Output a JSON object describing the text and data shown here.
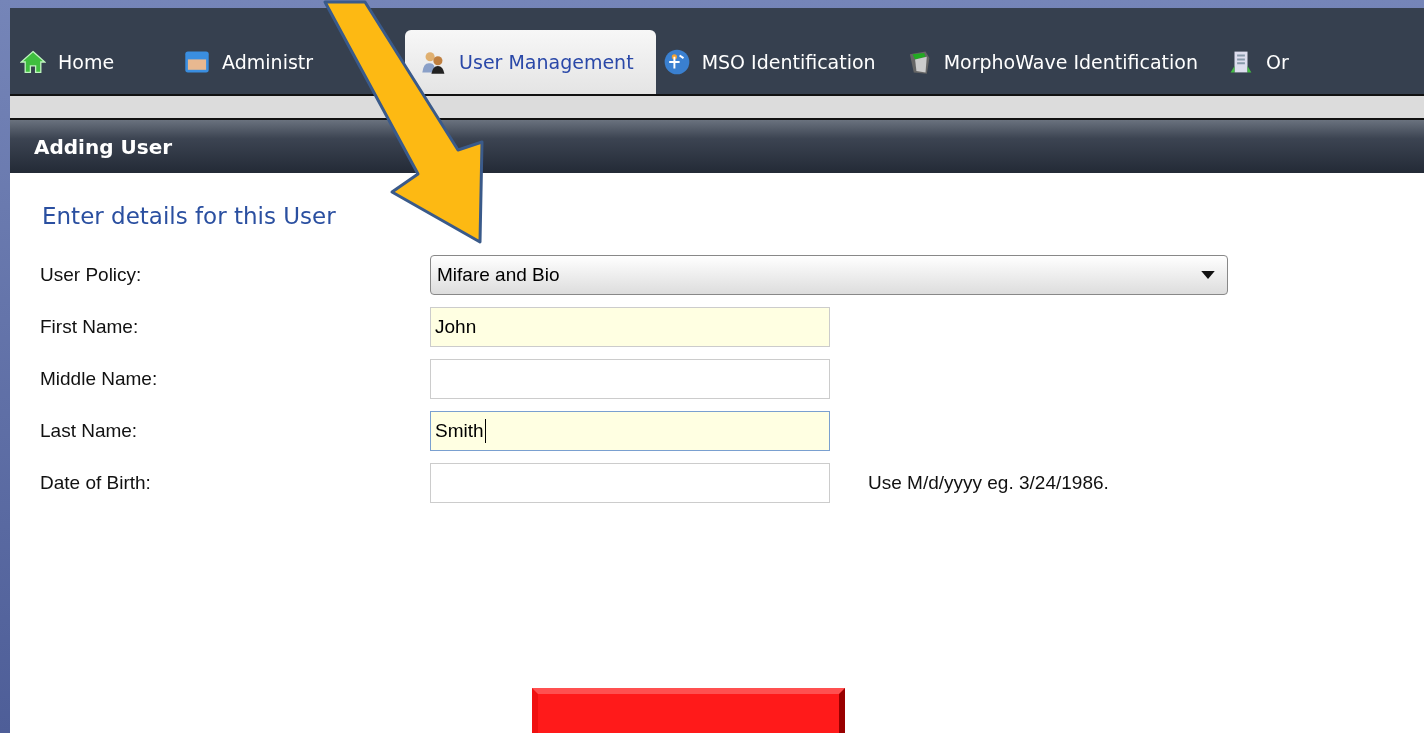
{
  "tabs": [
    {
      "label": "Home",
      "selected": false
    },
    {
      "label": "Administr",
      "selected": false
    },
    {
      "label": "User Management",
      "selected": true
    },
    {
      "label": "MSO Identification",
      "selected": false
    },
    {
      "label": "MorphoWave Identification",
      "selected": false
    },
    {
      "label": "Or",
      "selected": false
    }
  ],
  "panel": {
    "title": "Adding User"
  },
  "form": {
    "heading": "Enter details for this User",
    "fields": [
      {
        "label": "User Policy:",
        "kind": "select",
        "value": "Mifare and Bio"
      },
      {
        "label": "First Name:",
        "kind": "text",
        "value": "John",
        "highlighted": true,
        "focused": false
      },
      {
        "label": "Middle Name:",
        "kind": "text",
        "highlighted": false,
        "focused": false
      },
      {
        "label": "Last Name:",
        "kind": "text",
        "value": "Smith",
        "highlighted": true,
        "focused": true
      },
      {
        "label": "Date of Birth:",
        "kind": "text",
        "highlighted": false,
        "focused": false,
        "hint": "Use M/d/yyyy eg. 3/24/1986."
      }
    ]
  }
}
